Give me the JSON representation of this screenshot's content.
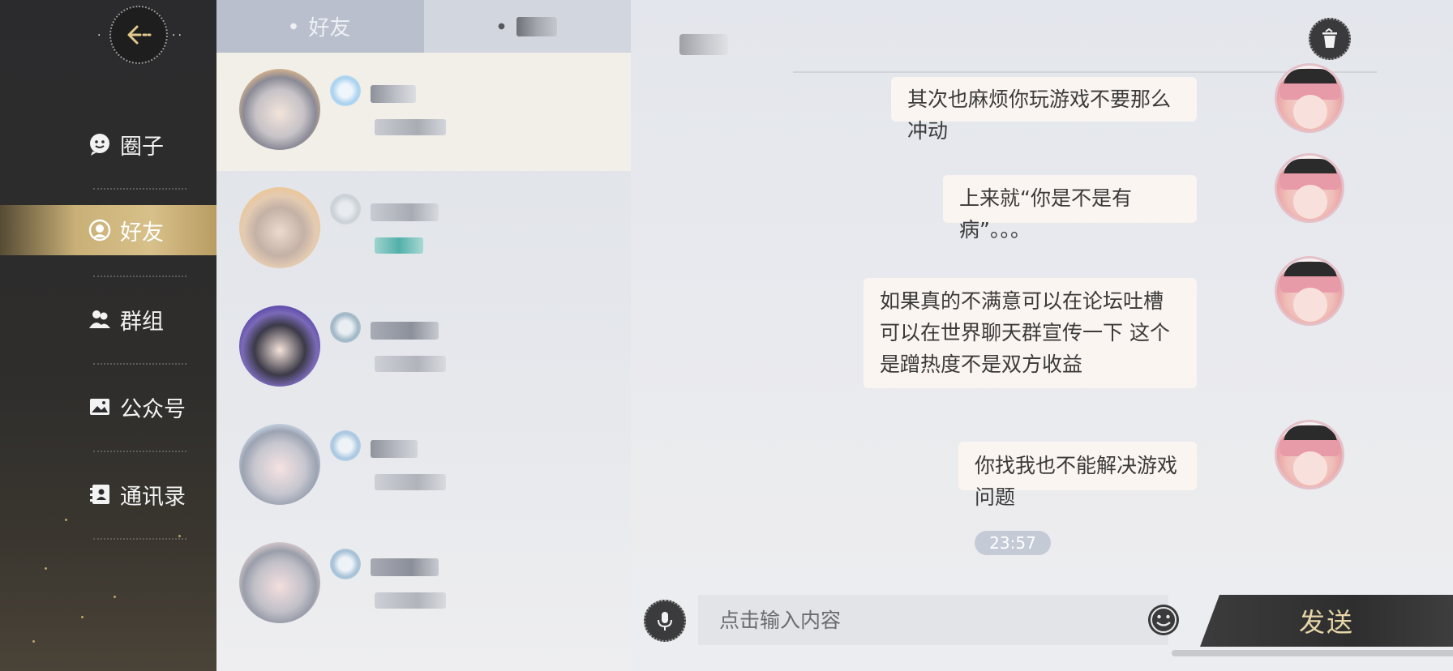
{
  "nav": {
    "back_icon": "arrow-left-icon",
    "items": [
      {
        "label": "圈子",
        "icon": "smiley-bubble-icon",
        "active": false
      },
      {
        "label": "好友",
        "icon": "friend-face-icon",
        "active": true
      },
      {
        "label": "群组",
        "icon": "group-people-icon",
        "active": false
      },
      {
        "label": "公众号",
        "icon": "image-gallery-icon",
        "active": false
      },
      {
        "label": "通讯录",
        "icon": "contact-book-icon",
        "active": false
      }
    ]
  },
  "friend_list": {
    "tabs": [
      {
        "label": "好友",
        "active": true
      },
      {
        "label": "",
        "active": false
      }
    ]
  },
  "chat": {
    "trash_icon": "trash-icon",
    "messages": [
      {
        "text": "其次也麻烦你玩游戏不要那么冲动",
        "sender": "me"
      },
      {
        "text": "上来就“你是不是有病”。。。",
        "sender": "me"
      },
      {
        "text": "如果真的不满意可以在论坛吐槽 可以在世界聊天群宣传一下 这个是蹭热度不是双方收益",
        "sender": "me"
      },
      {
        "text": "你找我也不能解决游戏问题",
        "sender": "me"
      }
    ],
    "timestamp": "23:57"
  },
  "input": {
    "placeholder": "点击输入内容",
    "value": "",
    "mic_icon": "microphone-icon",
    "emoji_icon": "emoji-icon",
    "send_label": "发送"
  },
  "colors": {
    "nav_bg": "#2b2b2d",
    "nav_active": "#d1b880",
    "bubble_bg": "#fbf5f1",
    "send_text": "#e6d6a8",
    "timestamp_bg": "#c4cad6"
  }
}
